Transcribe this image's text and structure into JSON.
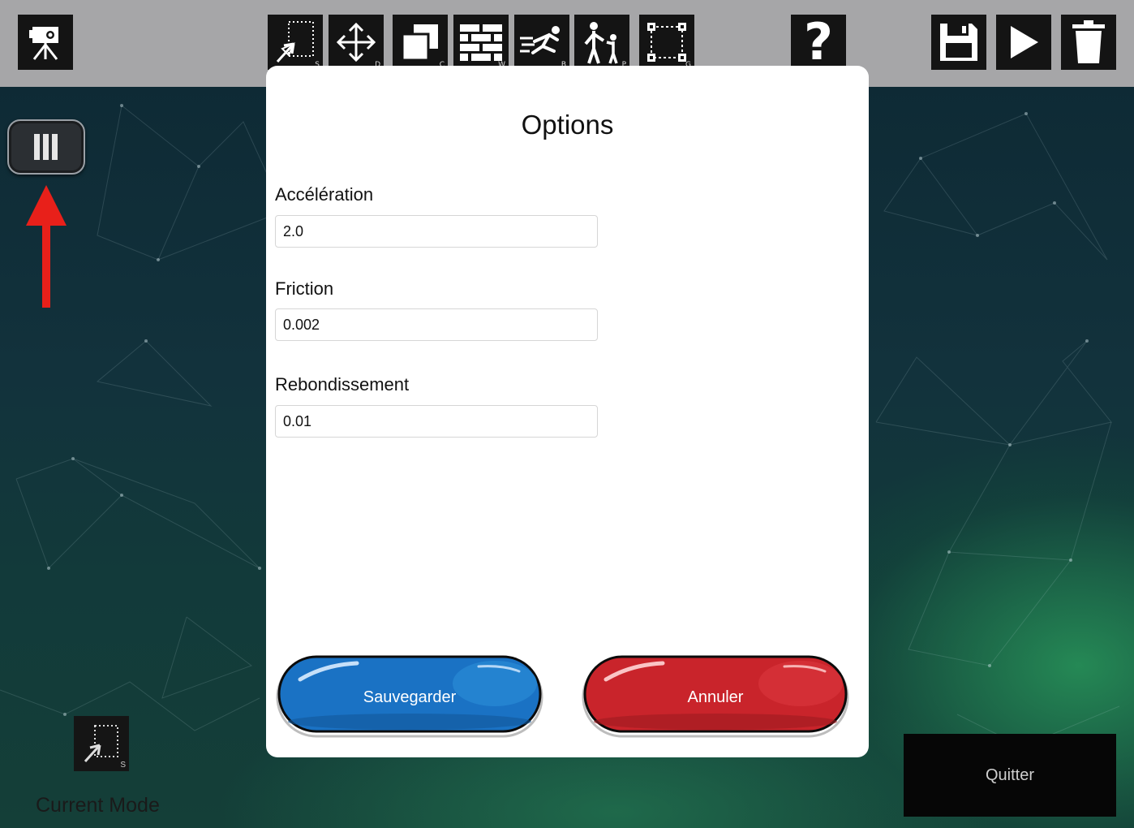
{
  "toolbar": {
    "camera_icon": "camera-tripod-icon",
    "tools": [
      {
        "name": "select",
        "key": "S",
        "icon": "select-cursor-icon"
      },
      {
        "name": "move",
        "key": "D",
        "icon": "move-arrows-icon"
      },
      {
        "name": "copy",
        "key": "C",
        "icon": "copy-squares-icon"
      },
      {
        "name": "wall",
        "key": "W",
        "icon": "brick-wall-icon"
      },
      {
        "name": "ball",
        "key": "B",
        "icon": "sprinter-icon"
      },
      {
        "name": "player",
        "key": "P",
        "icon": "people-icon"
      },
      {
        "name": "group",
        "key": "G",
        "icon": "group-selection-icon"
      }
    ],
    "help_label": "?",
    "right_icons": [
      "save-floppy-icon",
      "play-icon",
      "trash-icon"
    ]
  },
  "panel_toggle": {
    "icon": "three-bars-icon"
  },
  "modal": {
    "title": "Options",
    "fields": [
      {
        "label": "Accélération",
        "value": "2.0"
      },
      {
        "label": "Friction",
        "value": "0.002"
      },
      {
        "label": "Rebondissement",
        "value": "0.01"
      }
    ],
    "save_label": "Sauvegarder",
    "cancel_label": "Annuler"
  },
  "footer": {
    "current_mode_label": "Current Mode",
    "current_mode_key": "S",
    "quit_label": "Quitter"
  },
  "colors": {
    "toolbar_bg": "#a6a6a8",
    "save_button": "#1a72c4",
    "cancel_button": "#c9242b",
    "arrow_hint": "#e8201a"
  }
}
